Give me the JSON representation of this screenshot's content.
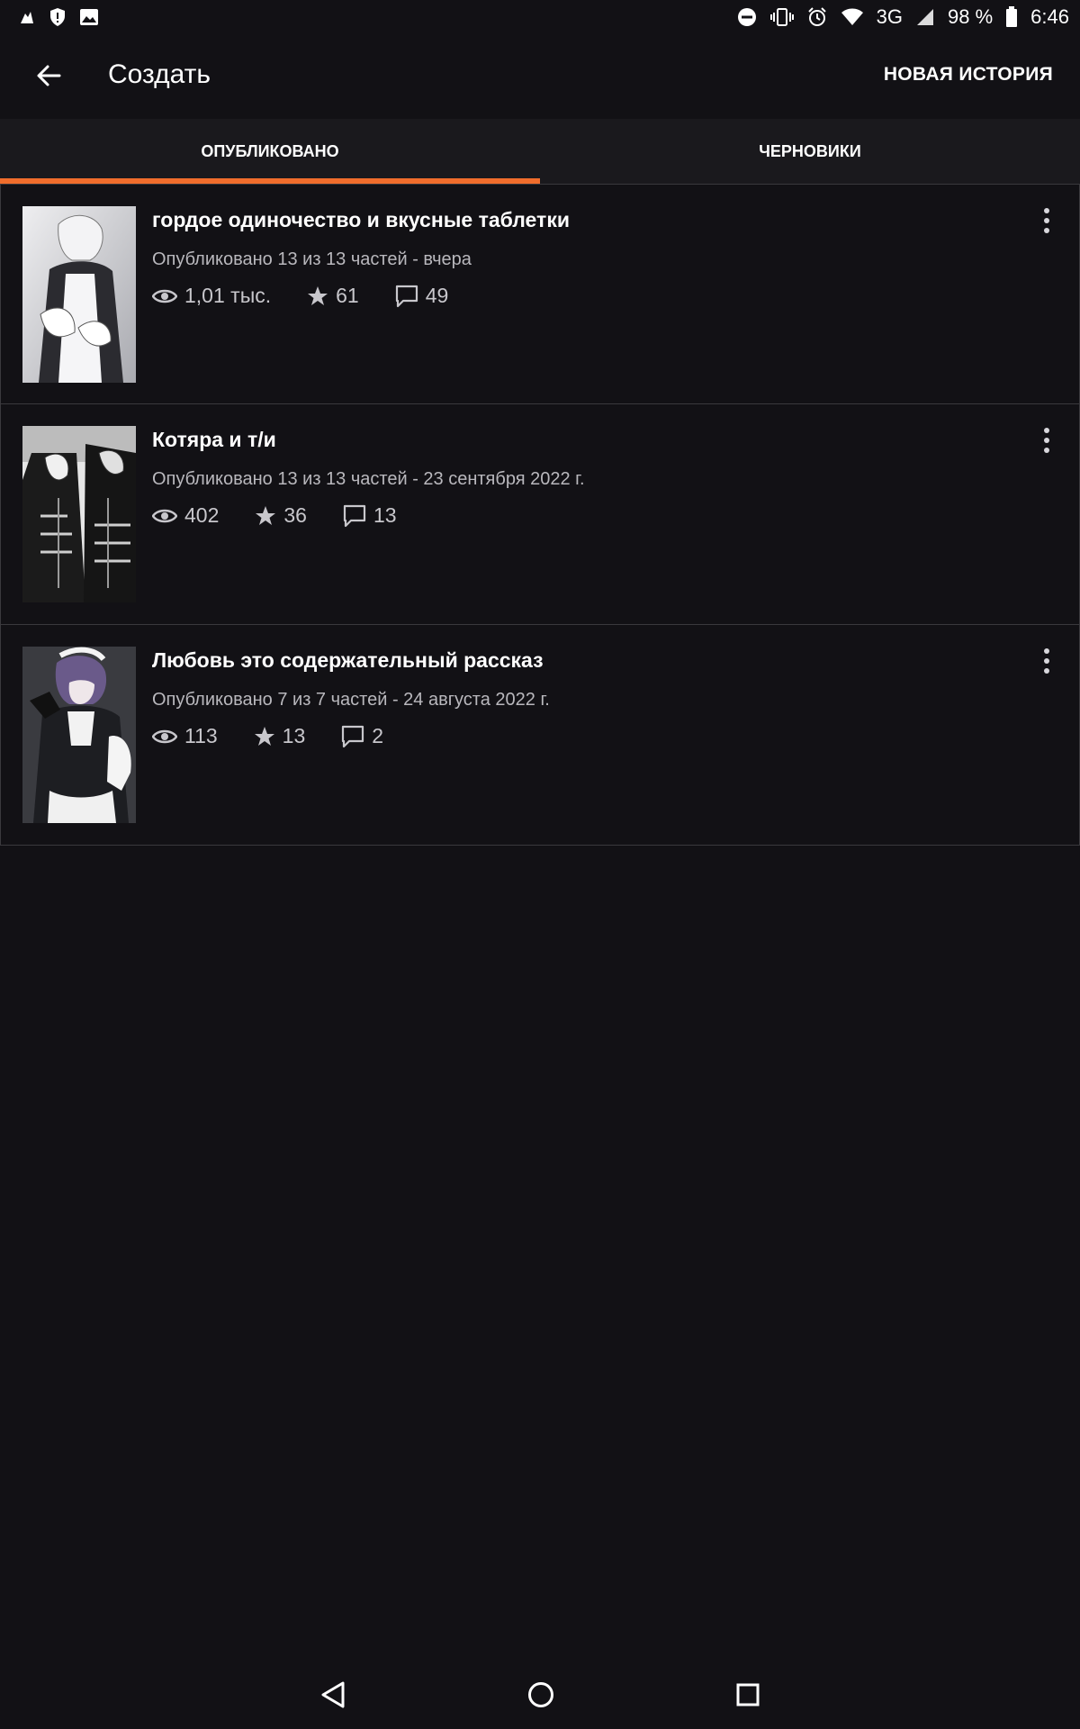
{
  "status_bar": {
    "battery": "98 %",
    "time": "6:46",
    "network": "3G"
  },
  "app_bar": {
    "title": "Создать",
    "new_story_label": "НОВАЯ ИСТОРИЯ"
  },
  "tabs": [
    {
      "label": "ОПУБЛИКОВАНО",
      "active": true
    },
    {
      "label": "ЧЕРНОВИКИ",
      "active": false
    }
  ],
  "stories": [
    {
      "title": "гордое одиночество и вкусные таблетки",
      "meta": "Опубликовано 13 из 13 частей - вчера",
      "views": "1,01 тыс.",
      "votes": "61",
      "comments": "49"
    },
    {
      "title": "Котяра и т/и",
      "meta": "Опубликовано 13 из 13 частей - 23 сентября 2022 г.",
      "views": "402",
      "votes": "36",
      "comments": "13"
    },
    {
      "title": "Любовь это содержательный рассказ",
      "meta": "Опубликовано 7 из 7 частей - 24 августа 2022 г.",
      "views": "113",
      "votes": "13",
      "comments": "2"
    }
  ],
  "colors": {
    "background": "#121115",
    "accent": "#f06d2c",
    "tab_bar": "#1a191d",
    "divider": "#3a393d"
  }
}
